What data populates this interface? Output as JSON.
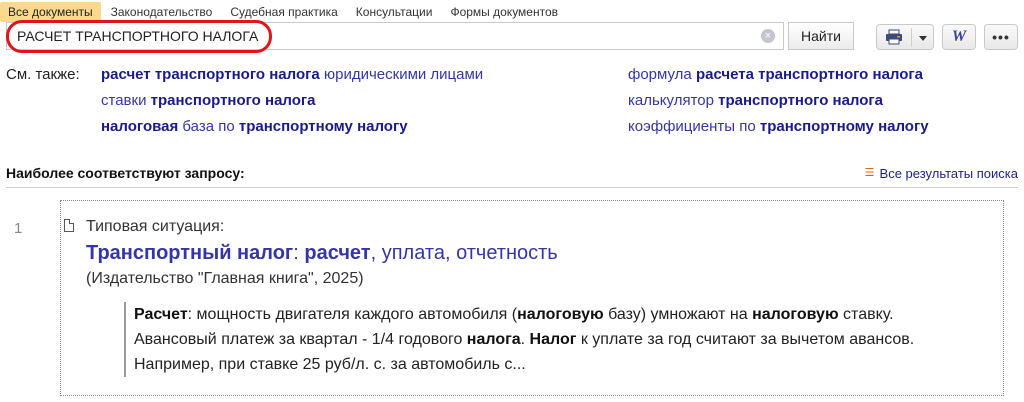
{
  "tabs": [
    {
      "label": "Все документы",
      "active": true
    },
    {
      "label": "Законодательство",
      "active": false
    },
    {
      "label": "Судебная практика",
      "active": false
    },
    {
      "label": "Консультации",
      "active": false
    },
    {
      "label": "Формы документов",
      "active": false
    }
  ],
  "search": {
    "value": "РАСЧЕТ ТРАНСПОРТНОГО НАЛОГА",
    "find_label": "Найти"
  },
  "toolbar": {
    "word_label": "W",
    "more_label": "•••"
  },
  "see_also": {
    "label": "См. также:",
    "left": [
      [
        {
          "t": "расчет транспортного налога",
          "b": true
        },
        {
          "t": " юридическими лицами",
          "b": false
        }
      ],
      [
        {
          "t": "ставки ",
          "b": false
        },
        {
          "t": "транспортного налога",
          "b": true
        }
      ],
      [
        {
          "t": "налоговая",
          "b": true
        },
        {
          "t": " база по ",
          "b": false
        },
        {
          "t": "транспортному налогу",
          "b": true
        }
      ]
    ],
    "right": [
      [
        {
          "t": "формула ",
          "b": false
        },
        {
          "t": "расчета транспортного налога",
          "b": true
        }
      ],
      [
        {
          "t": "калькулятор ",
          "b": false
        },
        {
          "t": "транспортного налога",
          "b": true
        }
      ],
      [
        {
          "t": "коэффициенты по ",
          "b": false
        },
        {
          "t": "транспортному налогу",
          "b": true
        }
      ]
    ]
  },
  "results_header": {
    "title": "Наиболее соответствуют запросу:",
    "all_results": "Все результаты поиска"
  },
  "result": {
    "number": "1",
    "type": "Типовая ситуация:",
    "title_parts": [
      {
        "t": "Транспортный налог",
        "b": true
      },
      {
        "t": ": ",
        "b": false
      },
      {
        "t": "расчет",
        "b": true
      },
      {
        "t": ", уплата, отчетность",
        "b": false
      }
    ],
    "source": "(Издательство \"Главная книга\", 2025)",
    "snippet": [
      {
        "t": "Расчет",
        "b": true
      },
      {
        "t": ": мощность двигателя каждого автомобиля (",
        "b": false
      },
      {
        "t": "налоговую",
        "b": true
      },
      {
        "t": " базу) умножают на ",
        "b": false
      },
      {
        "t": "налоговую",
        "b": true
      },
      {
        "t": " ставку. Авансовый платеж за квартал - 1/4 годового ",
        "b": false
      },
      {
        "t": "налога",
        "b": true
      },
      {
        "t": ". ",
        "b": false
      },
      {
        "t": "Налог",
        "b": true
      },
      {
        "t": " к уплате за год считают за вычетом авансов. Например, при ставке 25 руб/л. с. за автомобиль с...",
        "b": false
      }
    ]
  }
}
